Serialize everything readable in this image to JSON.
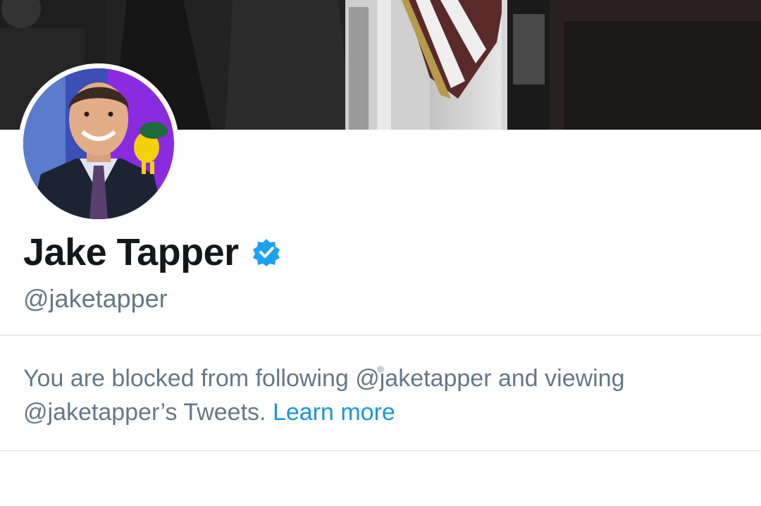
{
  "profile": {
    "display_name": "Jake Tapper",
    "handle": "@jaketapper",
    "verified_icon": "verified-badge-icon",
    "avatar_icon": "profile-photo"
  },
  "block_notice": {
    "line1": "You are blocked from following @jaketapper and viewing",
    "line2": "@jaketapper’s Tweets.",
    "learn_more_label": "Learn more"
  },
  "colors": {
    "name": "#14171a",
    "secondary_text": "#657786",
    "link": "#1b95e0",
    "verified": "#1da1f2",
    "divider": "#d6dce0"
  }
}
